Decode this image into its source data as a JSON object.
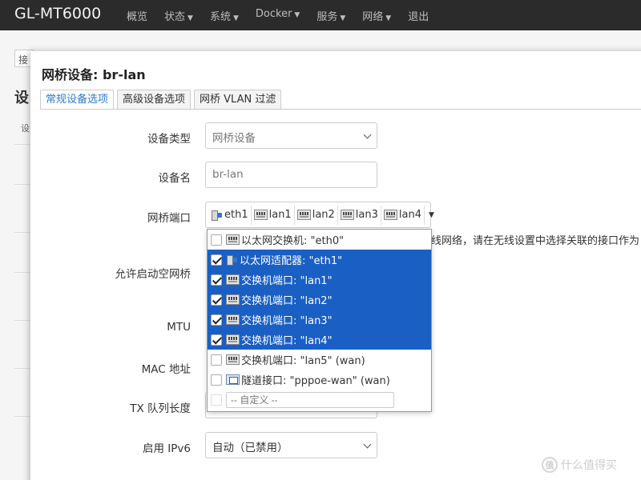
{
  "app": {
    "brand": "GL-MT6000"
  },
  "nav": [
    {
      "label": "概览",
      "has_caret": false
    },
    {
      "label": "状态",
      "has_caret": true
    },
    {
      "label": "系统",
      "has_caret": true
    },
    {
      "label": "Docker",
      "has_caret": true
    },
    {
      "label": "服务",
      "has_caret": true
    },
    {
      "label": "网络",
      "has_caret": true
    },
    {
      "label": "退出",
      "has_caret": false
    }
  ],
  "background": {
    "tab_label": "接",
    "heading": "设",
    "row_label": "设"
  },
  "modal": {
    "title": "网桥设备: br-lan",
    "tabs": [
      "常规设备选项",
      "高级设备选项",
      "网桥 VLAN 过滤"
    ],
    "fields": {
      "device_type": {
        "label": "设备类型",
        "value": "网桥设备"
      },
      "device_name": {
        "label": "设备名",
        "value": "br-lan"
      },
      "bridge_ports": {
        "label": "网桥端口"
      },
      "allow_empty": {
        "label": "允许启动空网桥"
      },
      "mtu": {
        "label": "MTU"
      },
      "mac": {
        "label": "MAC 地址"
      },
      "txqueue": {
        "label": "TX 队列长度"
      },
      "ipv6": {
        "label": "启用 IPv6",
        "value": "自动（已禁用）"
      }
    },
    "selected_ports": [
      "eth1",
      "lan1",
      "lan2",
      "lan3",
      "lan4"
    ],
    "hint": "线网络，请在无线设置中选择关联的接口作为"
  },
  "dropdown": {
    "options": [
      {
        "label": "以太网交换机: \"eth0\"",
        "icon": "switch-icon",
        "checked": false
      },
      {
        "label": "以太网适配器: \"eth1\"",
        "icon": "ethernet-adapter-icon",
        "checked": true
      },
      {
        "label": "交换机端口: \"lan1\"",
        "icon": "switch-port-icon",
        "checked": true
      },
      {
        "label": "交换机端口: \"lan2\"",
        "icon": "switch-port-icon",
        "checked": true
      },
      {
        "label": "交换机端口: \"lan3\"",
        "icon": "switch-port-icon",
        "checked": true
      },
      {
        "label": "交换机端口: \"lan4\"",
        "icon": "switch-port-icon",
        "checked": true
      },
      {
        "label": "交换机端口: \"lan5\" (wan)",
        "icon": "switch-port-icon",
        "checked": false
      },
      {
        "label": "隧道接口: \"pppoe-wan\" (wan)",
        "icon": "tunnel-icon",
        "checked": false
      }
    ],
    "custom_placeholder": "-- 自定义 --"
  },
  "watermark": {
    "text": "什么值得买",
    "icon_glyph": "值"
  },
  "colors": {
    "accent": "#2b7bd0",
    "selected_bg": "#1a5fc4",
    "topbar": "#2b2b2b"
  }
}
